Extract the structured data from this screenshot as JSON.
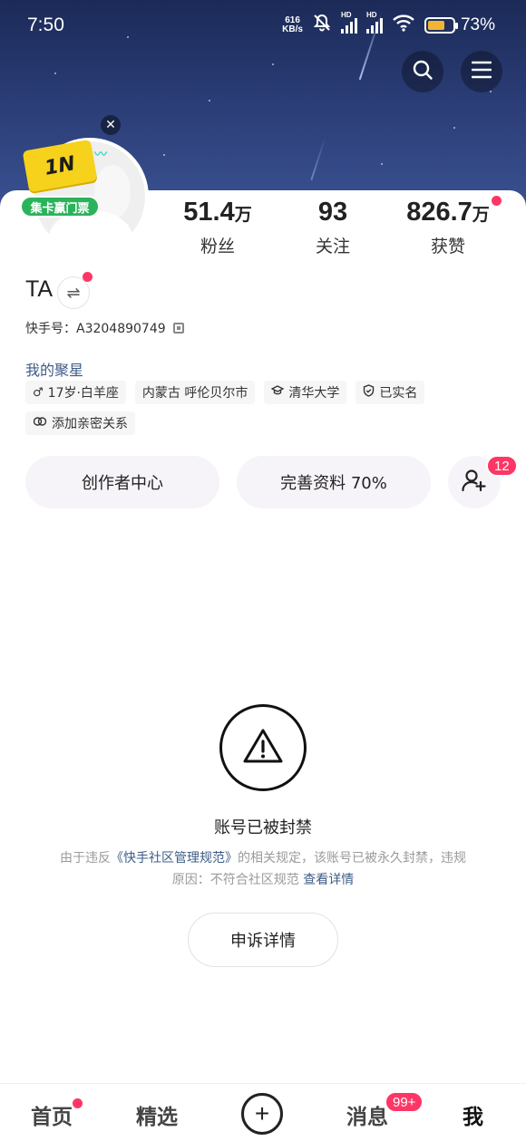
{
  "status_bar": {
    "time": "7:50",
    "net_speed_value": "616",
    "net_speed_unit": "KB/s",
    "hd1": "HD",
    "hd2": "HD",
    "battery_pct": "73%",
    "battery_level": 0.73
  },
  "header": {
    "icons": [
      "search-icon",
      "menu-icon"
    ]
  },
  "avatar_badge": {
    "ticket_text": "1N",
    "label": "集卡赢门票"
  },
  "stats": [
    {
      "num": "51.4",
      "unit": "万",
      "label": "粉丝"
    },
    {
      "num": "93",
      "unit": "",
      "label": "关注"
    },
    {
      "num": "826.7",
      "unit": "万",
      "label": "获赞"
    }
  ],
  "profile": {
    "nickname": "TA",
    "kuaishou_id": "快手号：A3204890749",
    "star_link": "我的聚星",
    "tags": [
      {
        "icon": "male-icon",
        "glyph": "♂",
        "text": "17岁·白羊座"
      },
      {
        "icon": "",
        "glyph": "",
        "text": "内蒙古 呼伦贝尔市"
      },
      {
        "icon": "graduation-cap-icon",
        "glyph": "🎓",
        "text": "清华大学"
      },
      {
        "icon": "shield-check-icon",
        "glyph": "⛉",
        "text": "已实名"
      },
      {
        "icon": "link-icon",
        "glyph": "♾",
        "text": "添加亲密关系"
      }
    ]
  },
  "actions": {
    "creator_center": "创作者中心",
    "complete_profile": "完善资料 70%",
    "friend_request_count": "12"
  },
  "banned": {
    "title": "账号已被封禁",
    "desc_prefix": "由于违反",
    "rule_link": "《快手社区管理规范》",
    "desc_middle": "的相关规定，该账号已被永久封禁，违规原因：不符合社区规范 ",
    "detail_link": "查看详情",
    "appeal_button": "申诉详情"
  },
  "tabbar": {
    "home": "首页",
    "featured": "精选",
    "plus": "+",
    "messages": "消息",
    "messages_badge": "99+",
    "me": "我"
  },
  "colors": {
    "accent_red": "#fe3666",
    "link_blue": "#3d5c86",
    "hero_top": "#1b2a57",
    "hero_bottom": "#3b5293"
  }
}
